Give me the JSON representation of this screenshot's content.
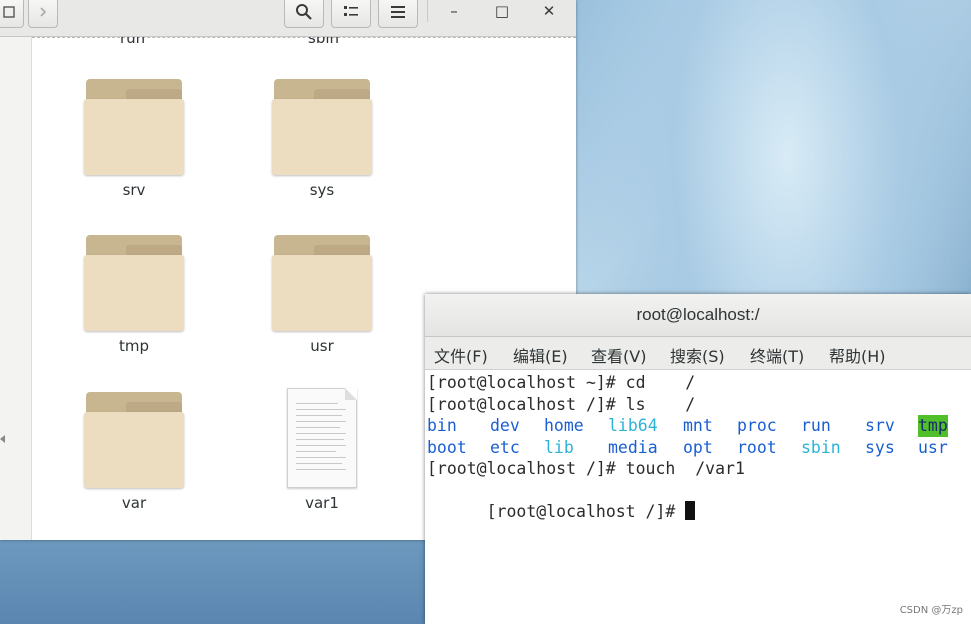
{
  "file_manager": {
    "toolbar": {
      "search_icon": "search-icon",
      "view_icon": "list-view-icon",
      "menu_icon": "hamburger-menu-icon"
    },
    "window_controls": {
      "minimize": "–",
      "maximize": "□",
      "close": "✕"
    },
    "partial_items": [
      "run",
      "sbin"
    ],
    "items": [
      {
        "label": "srv",
        "type": "folder"
      },
      {
        "label": "sys",
        "type": "folder"
      },
      {
        "label": "tmp",
        "type": "folder"
      },
      {
        "label": "usr",
        "type": "folder"
      },
      {
        "label": "var",
        "type": "folder"
      },
      {
        "label": "var1",
        "type": "file"
      }
    ]
  },
  "terminal": {
    "title": "root@localhost:/",
    "menu": [
      "文件(F)",
      "编辑(E)",
      "查看(V)",
      "搜索(S)",
      "终端(T)",
      "帮助(H)"
    ],
    "lines": [
      "[root@localhost ~]# cd    /",
      "[root@localhost /]# ls    /",
      "[root@localhost /]# touch  /var1",
      "[root@localhost /]# "
    ],
    "ls_row1": [
      "bin",
      "dev",
      "home",
      "lib64",
      "mnt",
      "proc",
      "run",
      "srv",
      "tmp"
    ],
    "ls_row2": [
      "boot",
      "etc",
      "lib",
      "media",
      "opt",
      "root",
      "sbin",
      "sys",
      "usr"
    ],
    "colors": {
      "dir": "#1a5fd1",
      "link": "#2cb3d6",
      "sticky_bg": "#4fbf2a"
    }
  },
  "watermark": "CSDN @万zp"
}
